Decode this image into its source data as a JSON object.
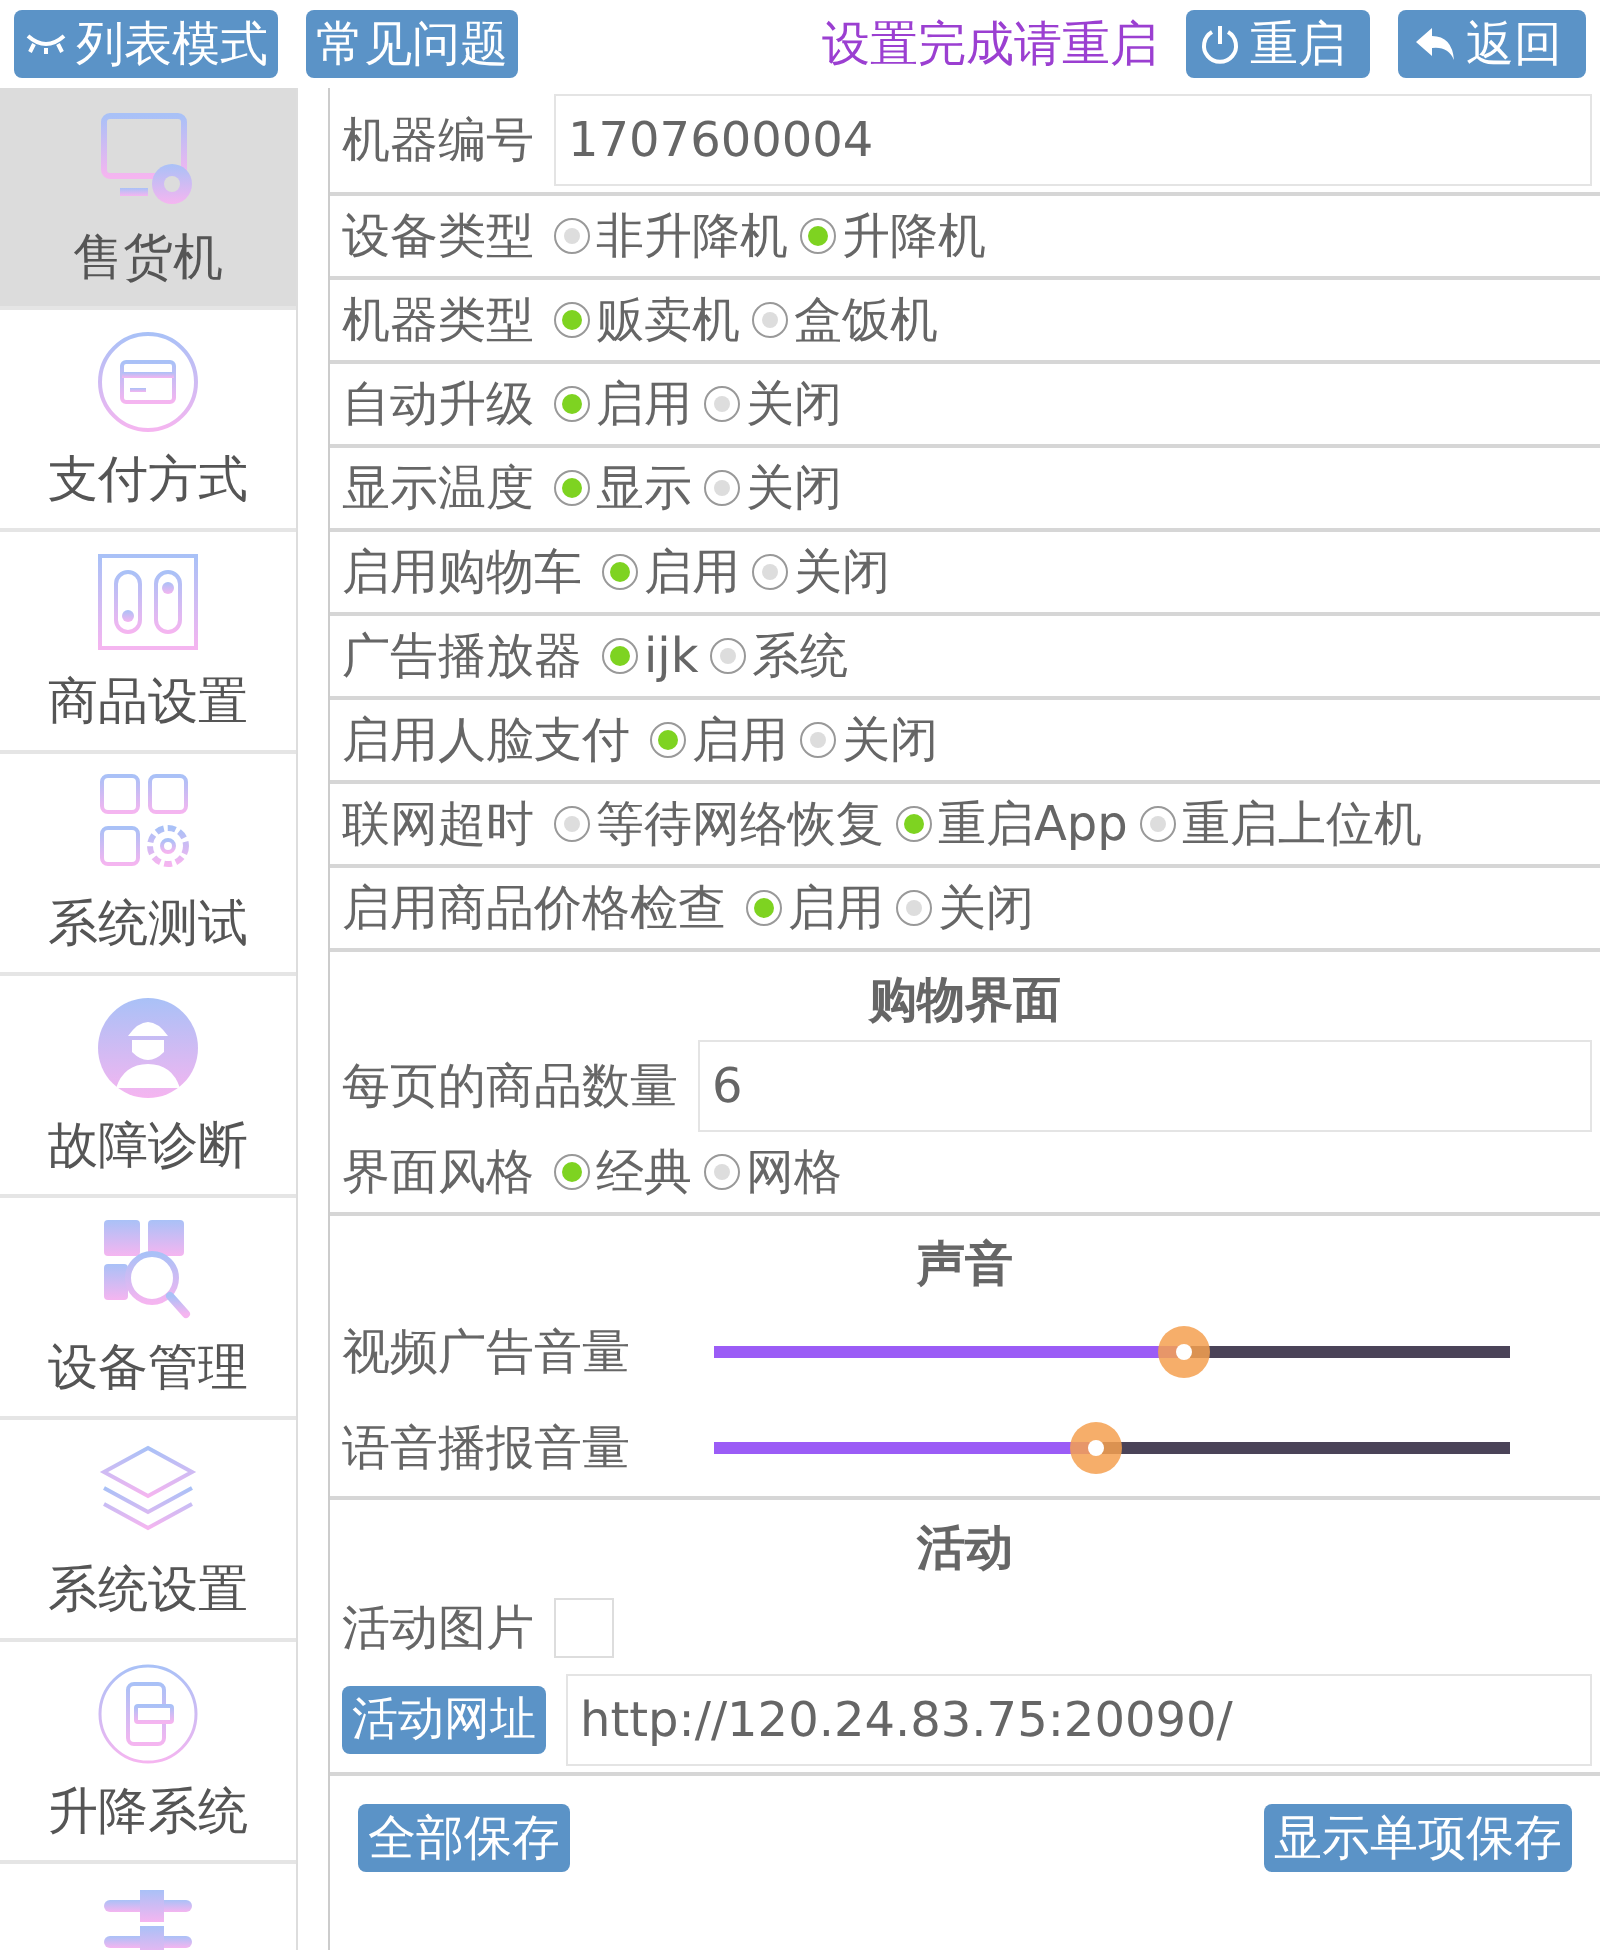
{
  "toolbar": {
    "list_mode_button": "列表模式",
    "faq_button": "常见问题",
    "restart_notice": "设置完成请重启",
    "restart_button": "重启",
    "back_button": "返回"
  },
  "sidebar": {
    "items": [
      {
        "kind": "vending",
        "label": "售货机",
        "selected": true
      },
      {
        "kind": "card",
        "label": "支付方式",
        "selected": false
      },
      {
        "kind": "slots",
        "label": "商品设置",
        "selected": false
      },
      {
        "kind": "grid",
        "label": "系统测试",
        "selected": false
      },
      {
        "kind": "worker",
        "label": "故障诊断",
        "selected": false
      },
      {
        "kind": "search",
        "label": "设备管理",
        "selected": false
      },
      {
        "kind": "layers",
        "label": "系统设置",
        "selected": false
      },
      {
        "kind": "phone",
        "label": "升降系统",
        "selected": false
      },
      {
        "kind": "sliders",
        "selected": false
      }
    ]
  },
  "sections": [
    {
      "rows": [
        {
          "kind": "text",
          "label": "机器编号",
          "value": "1707600004"
        },
        {
          "kind": "radio",
          "label": "设备类型",
          "options": [
            {
              "label": "非升降机",
              "selected": false
            },
            {
              "label": "升降机",
              "selected": true
            }
          ]
        },
        {
          "kind": "radio",
          "label": "机器类型",
          "options": [
            {
              "label": "贩卖机",
              "selected": true
            },
            {
              "label": "盒饭机",
              "selected": false
            }
          ]
        },
        {
          "kind": "radio",
          "label": "自动升级",
          "options": [
            {
              "label": "启用",
              "selected": true
            },
            {
              "label": "关闭",
              "selected": false
            }
          ]
        },
        {
          "kind": "radio",
          "label": "显示温度",
          "options": [
            {
              "label": "显示",
              "selected": true
            },
            {
              "label": "关闭",
              "selected": false
            }
          ]
        },
        {
          "kind": "radio",
          "label": "启用购物车",
          "options": [
            {
              "label": "启用",
              "selected": true
            },
            {
              "label": "关闭",
              "selected": false
            }
          ]
        },
        {
          "kind": "radio",
          "label": "广告播放器",
          "options": [
            {
              "label": "ijk",
              "selected": true
            },
            {
              "label": "系统",
              "selected": false
            }
          ]
        },
        {
          "kind": "radio",
          "label": "启用人脸支付",
          "options": [
            {
              "label": "启用",
              "selected": true
            },
            {
              "label": "关闭",
              "selected": false
            }
          ]
        },
        {
          "kind": "radio",
          "label": "联网超时",
          "options": [
            {
              "label": "等待网络恢复",
              "selected": false
            },
            {
              "label": "重启App",
              "selected": true
            },
            {
              "label": "重启上位机",
              "selected": false
            }
          ]
        },
        {
          "kind": "radio",
          "label": "启用商品价格检查",
          "options": [
            {
              "label": "启用",
              "selected": true
            },
            {
              "label": "关闭",
              "selected": false
            }
          ]
        }
      ]
    },
    {
      "title": "购物界面",
      "rows": [
        {
          "kind": "text",
          "label": "每页的商品数量",
          "value": "6"
        },
        {
          "kind": "radio",
          "label": "界面风格",
          "options": [
            {
              "label": "经典",
              "selected": true
            },
            {
              "label": "网格",
              "selected": false
            }
          ]
        }
      ]
    },
    {
      "title": "声音",
      "rows": [
        {
          "kind": "slider",
          "label": "视频广告音量",
          "level": 0.59
        },
        {
          "kind": "slider",
          "label": "语音播报音量",
          "level": 0.48
        }
      ]
    },
    {
      "title": "活动",
      "rows": [
        {
          "kind": "image",
          "label": "活动图片"
        },
        {
          "kind": "url",
          "label": "活动网址",
          "value": "http://120.24.83.75:20090/"
        }
      ]
    }
  ],
  "footer": {
    "save_all_button": "全部保存",
    "show_single_save_button": "显示单项保存"
  }
}
